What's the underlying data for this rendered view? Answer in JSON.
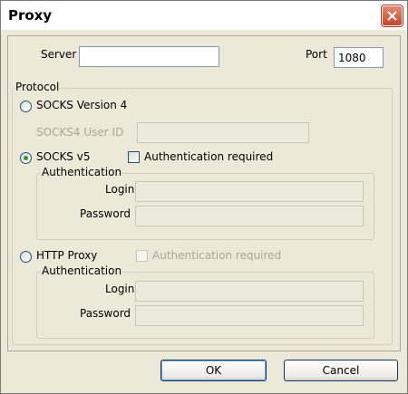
{
  "window": {
    "title": "Proxy"
  },
  "server": {
    "label": "Server",
    "value": ""
  },
  "port": {
    "label": "Port",
    "value": "1080"
  },
  "protocol": {
    "label": "Protocol",
    "socks4": {
      "label": "SOCKS Version 4",
      "user_id_label": "SOCKS4 User ID",
      "user_id_value": ""
    },
    "socks5": {
      "label": "SOCKS v5",
      "auth_required_label": "Authentication required",
      "auth_group_label": "Authentication",
      "login_label": "Login",
      "password_label": "Password"
    },
    "http": {
      "label": "HTTP Proxy",
      "auth_required_label": "Authentication required",
      "auth_group_label": "Authentication",
      "login_label": "Login",
      "password_label": "Password"
    },
    "selected": "socks5"
  },
  "buttons": {
    "ok": "OK",
    "cancel": "Cancel"
  },
  "colors": {
    "accent_close": "#c8452a",
    "radio_selected": "#21a121"
  }
}
